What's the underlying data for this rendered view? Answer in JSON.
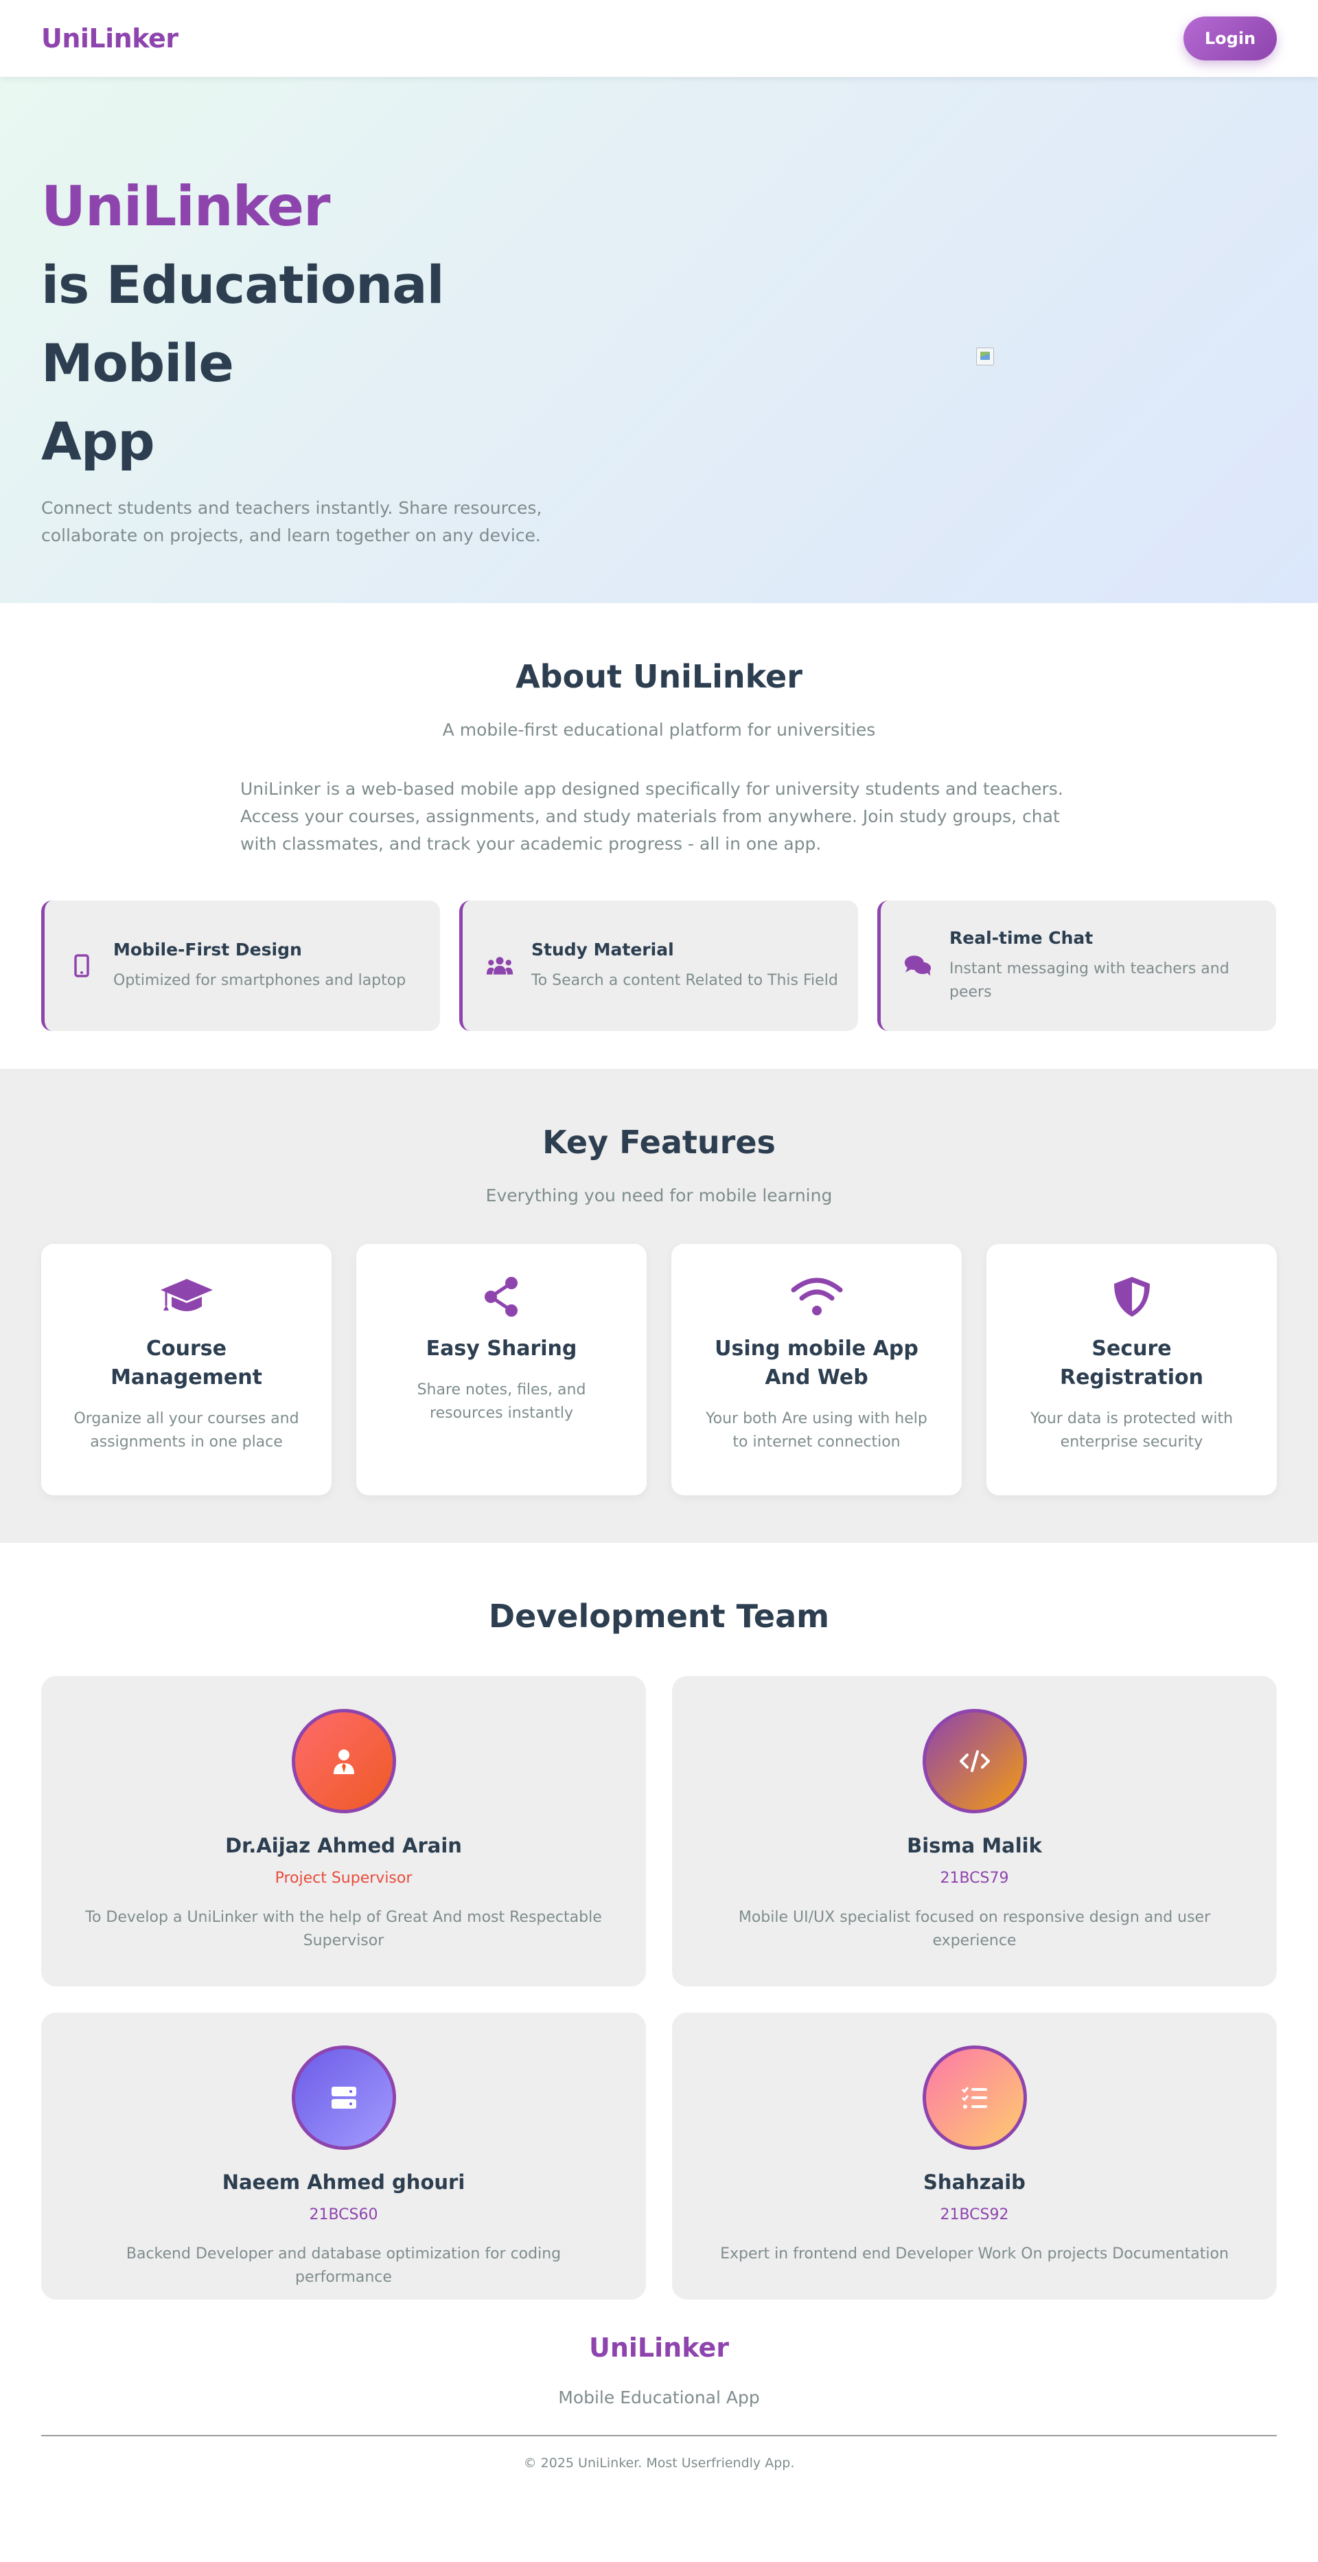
{
  "nav": {
    "logo": "UniLinker",
    "login_label": "Login"
  },
  "hero": {
    "brand": "UniLinker",
    "title_line1": "is Educational Mobile",
    "title_line2": "App",
    "subtitle": "Connect students and teachers instantly. Share resources, collaborate on projects, and learn together on any device."
  },
  "about": {
    "title": "About UniLinker",
    "subtitle": "A mobile-first educational platform for universities",
    "description": "UniLinker is a web-based mobile app designed specifically for university students and teachers. Access your courses, assignments, and study materials from anywhere. Join study groups, chat with classmates, and track your academic progress - all in one app.",
    "cards": [
      {
        "icon": "mobile-icon",
        "title": "Mobile-First Design",
        "text": "Optimized for smartphones and laptop"
      },
      {
        "icon": "users-icon",
        "title": "Study Material",
        "text": "To Search a content Related to This Field"
      },
      {
        "icon": "chat-icon",
        "title": "Real-time Chat",
        "text": "Instant messaging with teachers and peers"
      }
    ]
  },
  "features": {
    "title": "Key Features",
    "subtitle": "Everything you need for mobile learning",
    "cards": [
      {
        "icon": "graduation-cap-icon",
        "title": "Course Management",
        "text": "Organize all your courses and assignments in one place"
      },
      {
        "icon": "share-icon",
        "title": "Easy Sharing",
        "text": "Share notes, files, and resources instantly"
      },
      {
        "icon": "wifi-icon",
        "title": "Using mobile App And Web",
        "text": "Your both Are using with help to internet connection"
      },
      {
        "icon": "shield-icon",
        "title": "Secure Registration",
        "text": "Your data is protected with enterprise security"
      }
    ]
  },
  "team": {
    "title": "Development Team",
    "members": [
      {
        "icon": "user-tie-icon",
        "name": "Dr.Aijaz Ahmed Arain",
        "role": "Project Supervisor",
        "desc": "To Develop a UniLinker with the help of Great And most Respectable Supervisor",
        "role_color": "#e74c3c"
      },
      {
        "icon": "code-icon",
        "name": "Bisma Malik",
        "role": "21BCS79",
        "desc": "Mobile UI/UX specialist focused on responsive design and user experience",
        "role_color": "#8e44ad"
      },
      {
        "icon": "server-icon",
        "name": "Naeem Ahmed ghouri",
        "role": "21BCS60",
        "desc": "Backend Developer and database optimization for coding performance",
        "role_color": "#8e44ad"
      },
      {
        "icon": "tasks-icon",
        "name": "Shahzaib",
        "role": "21BCS92",
        "desc": "Expert in frontend end Developer Work On projects Documentation",
        "role_color": "#8e44ad"
      }
    ]
  },
  "footer": {
    "logo": "UniLinker",
    "tagline": "Mobile Educational App",
    "copyright": "© 2025 UniLinker. Most Userfriendly App."
  },
  "colors": {
    "primary": "#8e44ad",
    "dark": "#2c3e50",
    "muted": "#7f8c8d"
  }
}
